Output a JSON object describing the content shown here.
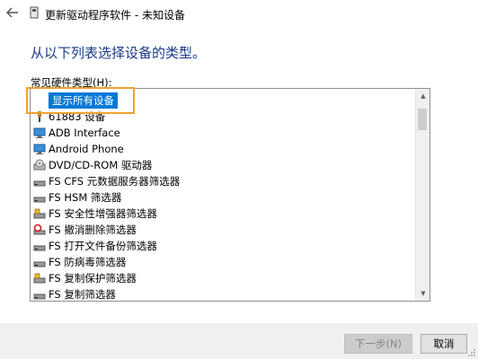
{
  "window": {
    "title": "更新驱动程序软件 - 未知设备"
  },
  "heading": "从以下列表选择设备的类型。",
  "list_label": "常见硬件类型(H):",
  "items": [
    {
      "label": "显示所有设备",
      "icon": "none",
      "selected": true
    },
    {
      "label": "61883 设备",
      "icon": "plug-icon"
    },
    {
      "label": "ADB Interface",
      "icon": "monitor-icon"
    },
    {
      "label": "Android Phone",
      "icon": "monitor-icon"
    },
    {
      "label": "DVD/CD-ROM 驱动器",
      "icon": "disc-drive-icon"
    },
    {
      "label": "FS CFS 元数据服务器筛选器",
      "icon": "drive-icon"
    },
    {
      "label": "FS HSM 筛选器",
      "icon": "drive-icon"
    },
    {
      "label": "FS 安全性增强器筛选器",
      "icon": "drive-lock-icon"
    },
    {
      "label": "FS 撤消删除筛选器",
      "icon": "undelete-icon"
    },
    {
      "label": "FS 打开文件备份筛选器",
      "icon": "drive-icon"
    },
    {
      "label": "FS 防病毒筛选器",
      "icon": "drive-icon"
    },
    {
      "label": "FS 复制保护筛选器",
      "icon": "drive-lock-icon"
    },
    {
      "label": "FS 复制筛选器",
      "icon": "drive-icon"
    }
  ],
  "buttons": {
    "next": "下一步(N)",
    "cancel": "取消"
  },
  "colors": {
    "heading": "#1a3a8a",
    "selection": "#0078d7",
    "highlight_box": "#f0a030"
  }
}
